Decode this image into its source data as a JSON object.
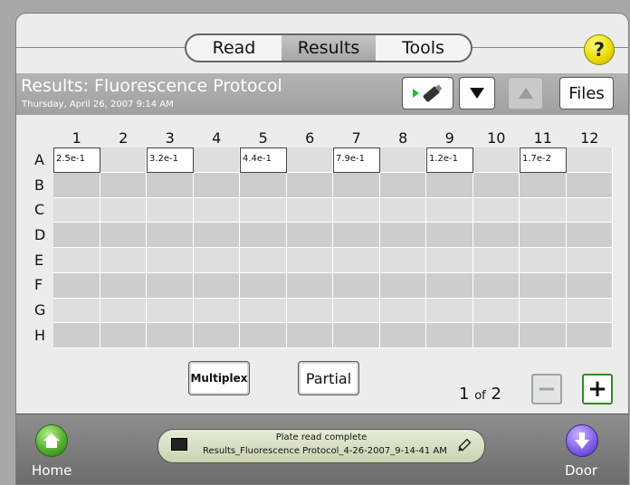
{
  "nav": {
    "tabs": [
      {
        "label": "Read",
        "active": false
      },
      {
        "label": "Results",
        "active": true
      },
      {
        "label": "Tools",
        "active": false
      }
    ],
    "help_label": "?"
  },
  "header": {
    "title": "Results: Fluorescence Protocol",
    "date": "Thursday, April 26, 2007 9:14 AM",
    "buttons": {
      "export_icon": "usb-export-icon",
      "down_icon": "triangle-down-icon",
      "up_icon": "triangle-up-icon",
      "files_label": "Files"
    }
  },
  "plate": {
    "columns": [
      "1",
      "2",
      "3",
      "4",
      "5",
      "6",
      "7",
      "8",
      "9",
      "10",
      "11",
      "12"
    ],
    "rows": [
      {
        "label": "A",
        "cells": [
          "2.5e-1",
          "",
          "3.2e-1",
          "",
          "4.4e-1",
          "",
          "7.9e-1",
          "",
          "1.2e-1",
          "",
          "1.7e-2",
          ""
        ]
      },
      {
        "label": "B",
        "cells": [
          "",
          "",
          "",
          "",
          "",
          "",
          "",
          "",
          "",
          "",
          "",
          ""
        ]
      },
      {
        "label": "C",
        "cells": [
          "",
          "",
          "",
          "",
          "",
          "",
          "",
          "",
          "",
          "",
          "",
          ""
        ]
      },
      {
        "label": "D",
        "cells": [
          "",
          "",
          "",
          "",
          "",
          "",
          "",
          "",
          "",
          "",
          "",
          ""
        ]
      },
      {
        "label": "E",
        "cells": [
          "",
          "",
          "",
          "",
          "",
          "",
          "",
          "",
          "",
          "",
          "",
          ""
        ]
      },
      {
        "label": "F",
        "cells": [
          "",
          "",
          "",
          "",
          "",
          "",
          "",
          "",
          "",
          "",
          "",
          ""
        ]
      },
      {
        "label": "G",
        "cells": [
          "",
          "",
          "",
          "",
          "",
          "",
          "",
          "",
          "",
          "",
          "",
          ""
        ]
      },
      {
        "label": "H",
        "cells": [
          "",
          "",
          "",
          "",
          "",
          "",
          "",
          "",
          "",
          "",
          "",
          ""
        ]
      }
    ]
  },
  "controls": {
    "multiplex_label": "Multiplex",
    "partial_label": "Partial",
    "page_current": "1",
    "page_of": "of",
    "page_total": "2",
    "minus_label": "−",
    "plus_label": "+"
  },
  "footer": {
    "home_label": "Home",
    "door_label": "Door",
    "status_line1": "Plate read complete",
    "status_line2": "Results_Fluorescence Protocol_4-26-2007_9-14-41 AM",
    "plate_icon": "plate-icon",
    "edit_icon": "pen-icon"
  },
  "colors": {
    "accent_green": "#4ea82b",
    "accent_purple": "#7d5ce6",
    "help_yellow": "#e8d800",
    "header_gray": "#a8a8a8"
  }
}
